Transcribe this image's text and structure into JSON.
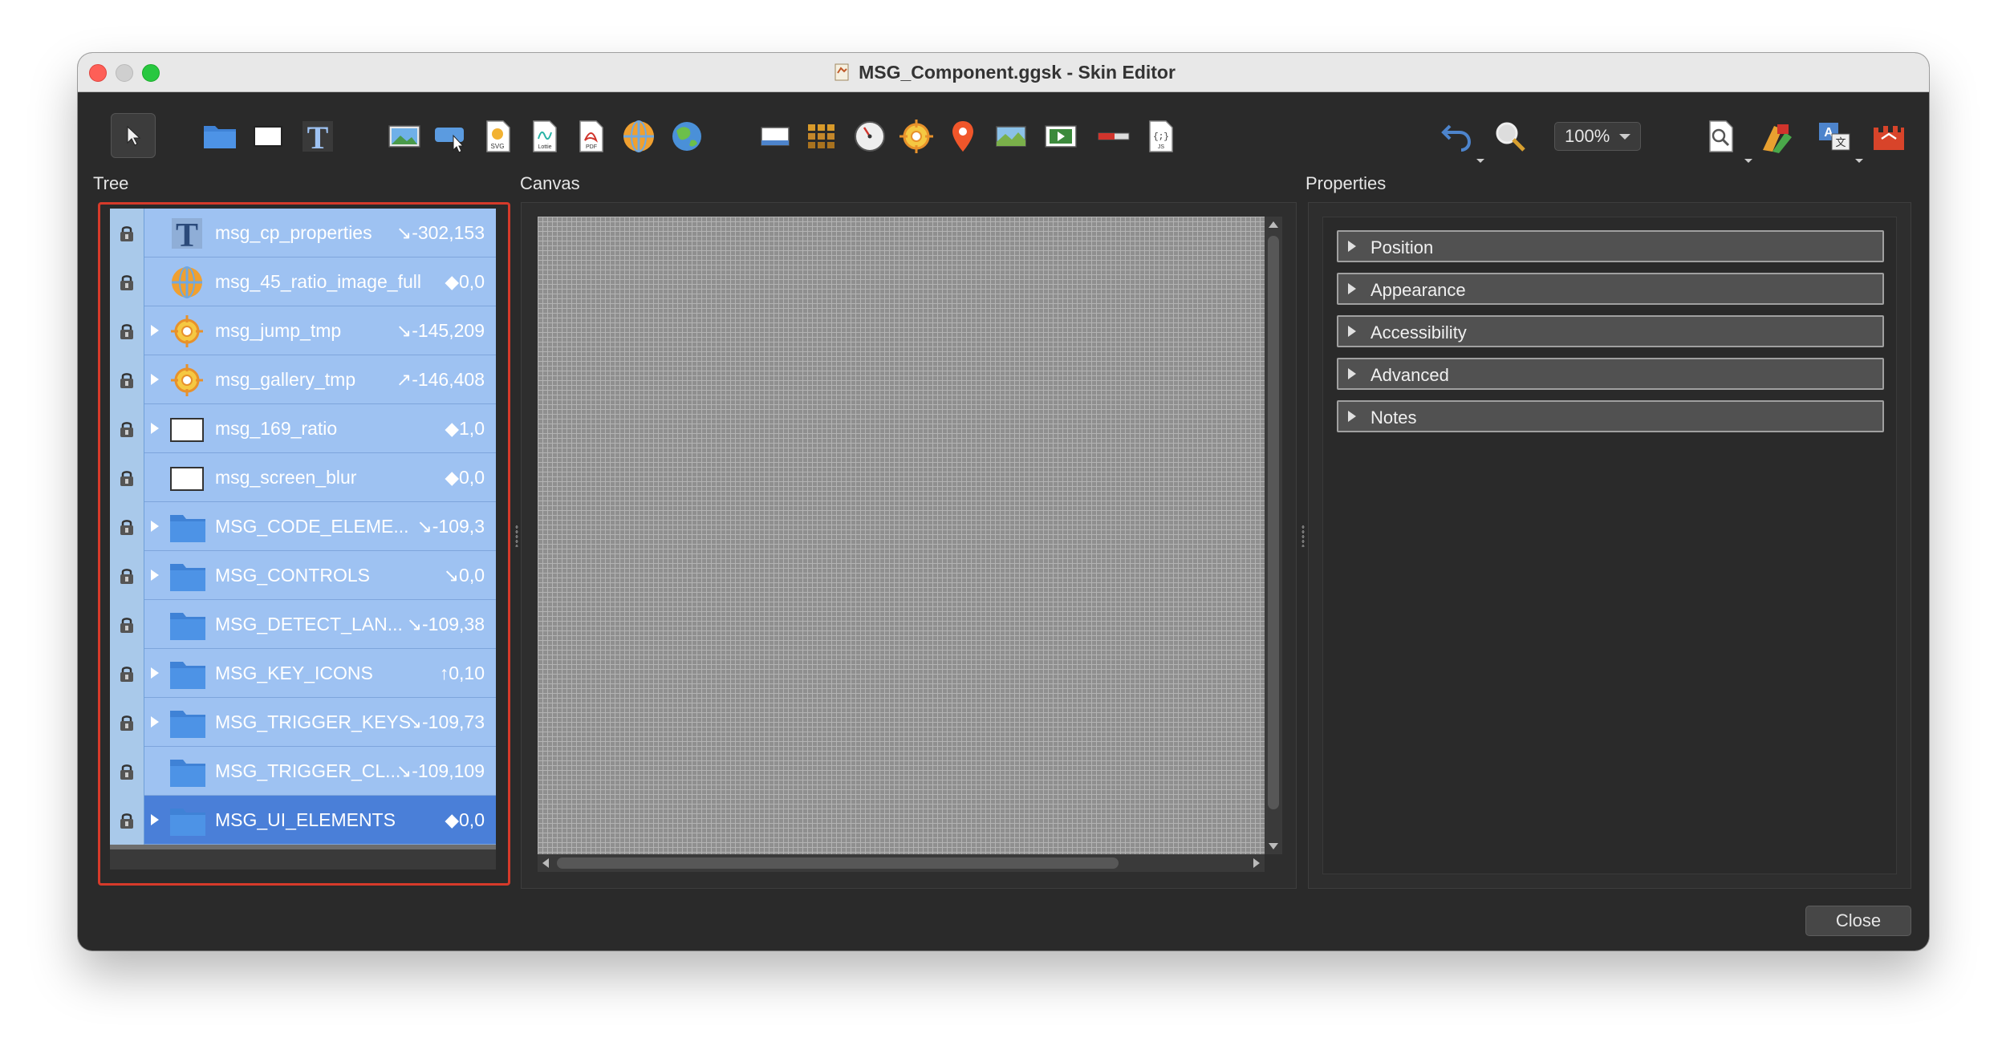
{
  "window": {
    "title": "MSG_Component.ggsk - Skin Editor"
  },
  "toolbar": {
    "zoom": "100%",
    "tools_left": [
      "select-pointer-icon"
    ],
    "tools_group1": [
      "container-folder-icon",
      "rectangle-icon",
      "text-icon"
    ],
    "tools_group2": [
      "image-icon",
      "button-cursor-icon",
      "svg-file-icon",
      "lottie-file-icon",
      "pdf-file-icon",
      "panorama-sphere-icon",
      "map-globe-icon"
    ],
    "tools_group3": [
      "hotspot-window-icon",
      "grid-icon",
      "gauge-dial-icon",
      "crosshair-target-icon",
      "map-pin-icon",
      "map-image-icon",
      "video-icon",
      "progress-bar-icon",
      "javascript-file-icon"
    ],
    "tools_right": [
      "undo-icon",
      "zoom-magnifier-icon",
      "find-document-icon",
      "color-palette-icon",
      "translate-icon",
      "skin-castle-icon"
    ]
  },
  "panels": {
    "tree_label": "Tree",
    "canvas_label": "Canvas",
    "properties_label": "Properties"
  },
  "tree": {
    "rows": [
      {
        "name": "msg_cp_properties",
        "coord": "↘-302,153",
        "icon": "text-icon",
        "expandable": false,
        "selected": false
      },
      {
        "name": "msg_45_ratio_image_full",
        "coord": "◆0,0",
        "icon": "panorama-sphere-icon",
        "expandable": false,
        "selected": false
      },
      {
        "name": "msg_jump_tmp",
        "coord": "↘-145,209",
        "icon": "crosshair-target-icon",
        "expandable": true,
        "selected": false
      },
      {
        "name": "msg_gallery_tmp",
        "coord": "↗-146,408",
        "icon": "crosshair-target-icon",
        "expandable": true,
        "selected": false
      },
      {
        "name": "msg_169_ratio",
        "coord": "◆1,0",
        "icon": "rectangle-icon",
        "expandable": true,
        "selected": false
      },
      {
        "name": "msg_screen_blur",
        "coord": "◆0,0",
        "icon": "rectangle-icon",
        "expandable": false,
        "selected": false
      },
      {
        "name": "MSG_CODE_ELEME...",
        "coord": "↘-109,3",
        "icon": "folder-icon",
        "expandable": true,
        "selected": false
      },
      {
        "name": "MSG_CONTROLS",
        "coord": "↘0,0",
        "icon": "folder-icon",
        "expandable": true,
        "selected": false
      },
      {
        "name": "MSG_DETECT_LAN...",
        "coord": "↘-109,38",
        "icon": "folder-icon",
        "expandable": false,
        "selected": false
      },
      {
        "name": "MSG_KEY_ICONS",
        "coord": "↑0,10",
        "icon": "folder-icon",
        "expandable": true,
        "selected": false
      },
      {
        "name": "MSG_TRIGGER_KEYS",
        "coord": "↘-109,73",
        "icon": "folder-icon",
        "expandable": true,
        "selected": false
      },
      {
        "name": "MSG_TRIGGER_CL...",
        "coord": "↘-109,109",
        "icon": "folder-icon",
        "expandable": false,
        "selected": false
      },
      {
        "name": "MSG_UI_ELEMENTS",
        "coord": "◆0,0",
        "icon": "folder-icon",
        "expandable": true,
        "selected": true
      }
    ]
  },
  "properties": {
    "sections": [
      "Position",
      "Appearance",
      "Accessibility",
      "Advanced",
      "Notes"
    ]
  },
  "footer": {
    "close_label": "Close"
  },
  "colors": {
    "window_bg": "#2a2a2a",
    "tree_row": "#9ec2f2",
    "tree_row_selected": "#4a7fd8",
    "highlight_border": "#d63a2a",
    "folder_blue": "#3f82d6"
  }
}
